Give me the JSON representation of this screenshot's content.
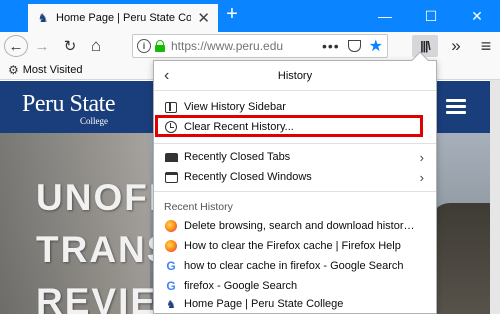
{
  "tab": {
    "title": "Home Page | Peru State College",
    "close_glyph": "✕",
    "new_tab_glyph": "+"
  },
  "window_controls": {
    "minimize": "—",
    "maximize": "☐",
    "close": "✕"
  },
  "navbar": {
    "back_glyph": "←",
    "forward_glyph": "→",
    "reload_glyph": "↻",
    "home_glyph": "⌂",
    "url": "https://www.peru.edu",
    "info_glyph": "i",
    "page_actions_glyph": "•••",
    "star_glyph": "★",
    "library_glyph": "|||\\",
    "overflow_glyph": "»",
    "menu_glyph": "≡"
  },
  "bookmarks": {
    "most_visited": "Most Visited"
  },
  "site": {
    "logo_line1": "Peru State",
    "logo_line2": "College",
    "hero_lines": [
      "UNOFF",
      "TRANS",
      "REVIEW"
    ]
  },
  "history_panel": {
    "title": "History",
    "back_glyph": "‹",
    "items": {
      "view_sidebar": "View History Sidebar",
      "clear_recent": "Clear Recent History...",
      "recently_closed_tabs": "Recently Closed Tabs",
      "recently_closed_windows": "Recently Closed Windows"
    },
    "chevron": "›",
    "recent_label": "Recent History",
    "recent": [
      {
        "title": "Delete browsing, search and download history on Fi...",
        "icon": "firefox-icon"
      },
      {
        "title": "How to clear the Firefox cache | Firefox Help",
        "icon": "firefox-icon"
      },
      {
        "title": "how to clear cache in firefox - Google Search",
        "icon": "google-icon"
      },
      {
        "title": "firefox - Google Search",
        "icon": "google-icon"
      },
      {
        "title": "Home Page | Peru State College",
        "icon": "peru-icon"
      }
    ]
  },
  "colors": {
    "tabstrip": "#0a84ff",
    "highlight": "#e00000",
    "site_header": "#1a3d7c"
  }
}
